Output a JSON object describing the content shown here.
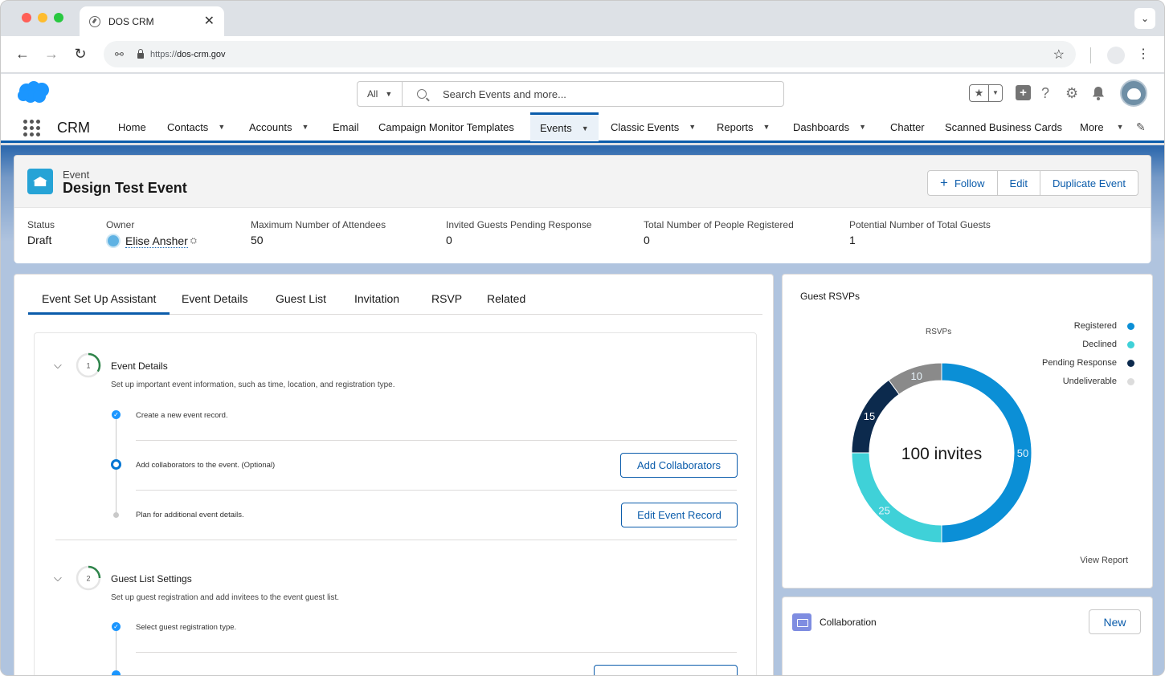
{
  "browser": {
    "tab_title": "DOS CRM",
    "tab_close": "✕",
    "url_scheme": "https://",
    "url_host": "dos-crm.gov",
    "back": "←",
    "forward": "→",
    "reload": "↻",
    "bookmark": "☆",
    "menu": "⋮",
    "tab_dropdown": "⌄"
  },
  "header": {
    "search_scope": "All",
    "search_placeholder": "Search Events and more...",
    "utility": {
      "help": "?",
      "setup": "⚙",
      "bell": "🔔"
    }
  },
  "nav": {
    "app_name": "CRM",
    "items": [
      {
        "label": "Home",
        "has_menu": false
      },
      {
        "label": "Contacts",
        "has_menu": true
      },
      {
        "label": "Accounts",
        "has_menu": true
      },
      {
        "label": "Email",
        "has_menu": false
      },
      {
        "label": "Campaign Monitor Templates",
        "has_menu": false
      },
      {
        "label": "Events",
        "has_menu": true,
        "active": true
      },
      {
        "label": "Classic Events",
        "has_menu": true
      },
      {
        "label": "Reports",
        "has_menu": true
      },
      {
        "label": "Dashboards",
        "has_menu": true
      },
      {
        "label": "Chatter",
        "has_menu": false
      },
      {
        "label": "Scanned Business Cards",
        "has_menu": false
      },
      {
        "label": "More",
        "has_menu": true
      }
    ]
  },
  "record": {
    "object_type": "Event",
    "title": "Design Test Event",
    "actions": {
      "follow": "Follow",
      "edit": "Edit",
      "duplicate": "Duplicate Event"
    },
    "highlights": [
      {
        "label": "Status",
        "value": "Draft"
      },
      {
        "label": "Owner",
        "value": "Elise Ansher"
      },
      {
        "label": "Maximum Number of Attendees",
        "value": "50"
      },
      {
        "label": "Invited Guests Pending Response",
        "value": "0"
      },
      {
        "label": "Total Number of People Registered",
        "value": "0"
      },
      {
        "label": "Potential Number of Total Guests",
        "value": "1"
      }
    ]
  },
  "tabs": [
    "Event Set Up Assistant",
    "Event Details",
    "Guest List",
    "Invitation",
    "RSVP",
    "Related"
  ],
  "assistant": {
    "sections": [
      {
        "number": "1",
        "title": "Event Details",
        "description": "Set up important event information, such as time, location, and registration type.",
        "steps": [
          {
            "text": "Create a new event record.",
            "status": "done"
          },
          {
            "text": "Add collaborators to the event. (Optional)",
            "status": "current",
            "button": "Add Collaborators"
          },
          {
            "text": "Plan for additional event details.",
            "status": "pending",
            "button": "Edit Event Record"
          }
        ]
      },
      {
        "number": "2",
        "title": "Guest List Settings",
        "description": "Set up guest registration and add invitees to the event guest list.",
        "steps": [
          {
            "text": "Select guest registration type.",
            "status": "done"
          }
        ]
      }
    ]
  },
  "rsvp_card": {
    "title": "Guest RSVPs",
    "view_report": "View Report",
    "legend": [
      {
        "label": "Registered",
        "color": "#0b8fd6"
      },
      {
        "label": "Declined",
        "color": "#3fd1d8"
      },
      {
        "label": "Pending Response",
        "color": "#0c2a4d"
      },
      {
        "label": "Undeliverable",
        "color": "#c9c9c9"
      }
    ]
  },
  "chart_data": {
    "type": "pie",
    "title": "RSVPs",
    "center_label": "100 invites",
    "categories": [
      "Registered",
      "Declined",
      "Pending Response",
      "Undeliverable"
    ],
    "values": [
      50,
      25,
      15,
      10
    ],
    "colors": [
      "#0b8fd6",
      "#3fd1d8",
      "#0c2a4d",
      "#8a8a8a"
    ],
    "donut": true
  },
  "collaboration": {
    "title": "Collaboration",
    "new_button": "New"
  }
}
